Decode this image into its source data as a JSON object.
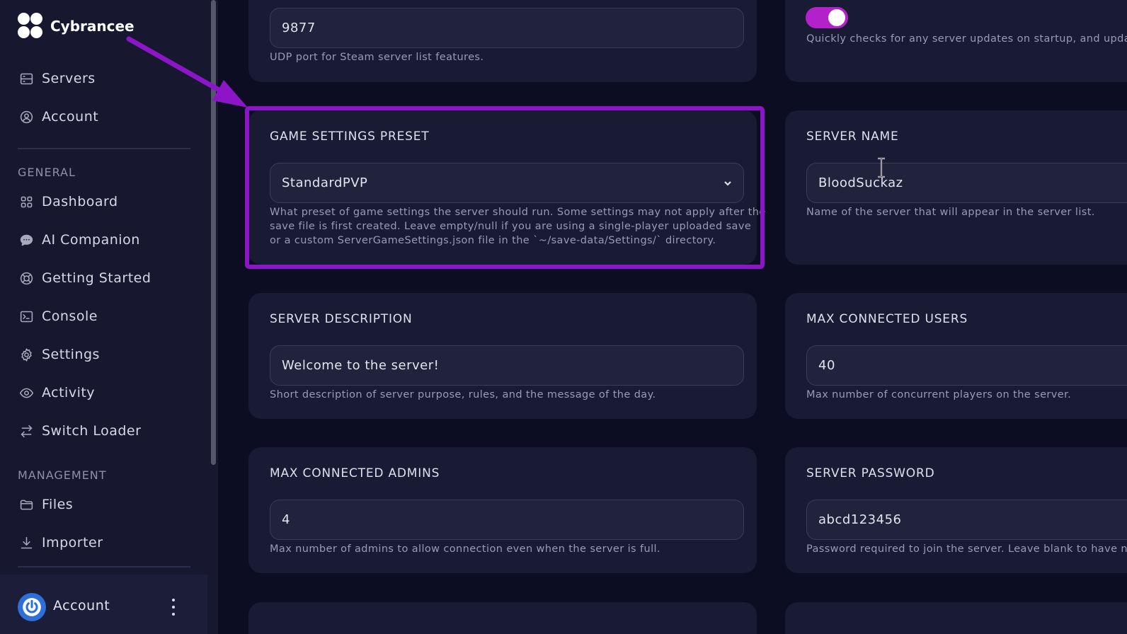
{
  "brand": {
    "name": "Cybrancee"
  },
  "nav": {
    "top": [
      {
        "label": "Servers",
        "icon": "server-icon"
      },
      {
        "label": "Account",
        "icon": "user-circle-icon"
      }
    ],
    "general_title": "GENERAL",
    "general": [
      {
        "label": "Dashboard",
        "icon": "grid-icon"
      },
      {
        "label": "AI Companion",
        "icon": "chat-bubble-icon"
      },
      {
        "label": "Getting Started",
        "icon": "lifebuoy-icon"
      },
      {
        "label": "Console",
        "icon": "terminal-icon"
      },
      {
        "label": "Settings",
        "icon": "gear-icon"
      },
      {
        "label": "Activity",
        "icon": "eye-icon"
      },
      {
        "label": "Switch Loader",
        "icon": "swap-icon"
      }
    ],
    "management_title": "MANAGEMENT",
    "management": [
      {
        "label": "Files",
        "icon": "folder-icon"
      },
      {
        "label": "Importer",
        "icon": "download-icon"
      }
    ]
  },
  "account_bar": {
    "name": "Account"
  },
  "settings": {
    "query_port": {
      "value": "9877",
      "help": "UDP port for Steam server list features."
    },
    "auto_update": {
      "enabled": true,
      "help": "Quickly checks for any server updates on startup, and upda"
    },
    "preset": {
      "title": "GAME SETTINGS PRESET",
      "value": "StandardPVP",
      "help1": "What preset of game settings the server should run. Some settings may not apply after the",
      "help2": "save file is first created. Leave empty/null if you are using a single-player uploaded save",
      "help3": "or a custom ServerGameSettings.json file in the `~/save-data/Settings/` directory."
    },
    "server_name": {
      "title": "SERVER NAME",
      "value": "BloodSuckaz",
      "help": "Name of the server that will appear in the server list."
    },
    "description": {
      "title": "SERVER DESCRIPTION",
      "value": "Welcome to the server!",
      "help": "Short description of server purpose, rules, and the message of the day."
    },
    "max_users": {
      "title": "MAX CONNECTED USERS",
      "value": "40",
      "help": "Max number of concurrent players on the server."
    },
    "max_admins": {
      "title": "MAX CONNECTED ADMINS",
      "value": "4",
      "help": "Max number of admins to allow connection even when the server is full."
    },
    "password": {
      "title": "SERVER PASSWORD",
      "value": "abcd123456",
      "help": "Password required to join the server. Leave blank to have n"
    }
  },
  "colors": {
    "accent": "#b221c9",
    "highlight": "#8c15c8",
    "background": "#0c0d22",
    "card": "#191a34"
  }
}
